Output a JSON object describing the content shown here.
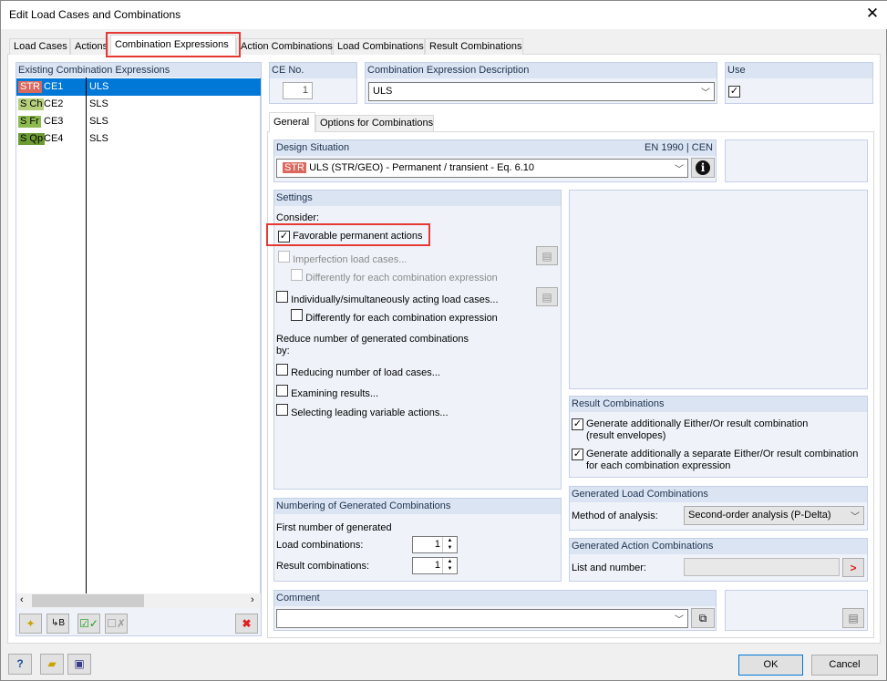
{
  "window": {
    "title": "Edit Load Cases and Combinations",
    "close": "✕"
  },
  "tabs": [
    "Load Cases",
    "Actions",
    "Combination Expressions",
    "Action Combinations",
    "Load Combinations",
    "Result Combinations"
  ],
  "left": {
    "header": "Existing Combination Expressions",
    "rows": [
      {
        "tag": "STR",
        "tag_color": "#d9695f",
        "name": "CE1",
        "desc": "ULS"
      },
      {
        "tag": "S Ch",
        "tag_color": "#b5cf7d",
        "name": "CE2",
        "desc": "SLS"
      },
      {
        "tag": "S Fr",
        "tag_color": "#8dba4f",
        "name": "CE3",
        "desc": "SLS"
      },
      {
        "tag": "S Qp",
        "tag_color": "#6d9b33",
        "name": "CE4",
        "desc": "SLS"
      }
    ]
  },
  "ce_no": {
    "label": "CE No.",
    "value": "1"
  },
  "description": {
    "label": "Combination Expression Description",
    "value": "ULS"
  },
  "use": {
    "label": "Use",
    "checked": true
  },
  "inner_tabs": [
    "General",
    "Options for Combinations"
  ],
  "design_situation": {
    "label": "Design Situation",
    "standard": "EN 1990 | CEN",
    "tag": "STR",
    "value": "ULS (STR/GEO) - Permanent / transient - Eq. 6.10"
  },
  "settings": {
    "label": "Settings",
    "consider": "Consider:",
    "favorable": "Favorable permanent actions",
    "imperfection": "Imperfection load cases...",
    "diff1": "Differently for each combination expression",
    "individually": "Individually/simultaneously acting load cases...",
    "diff2": "Differently for each combination expression",
    "reduce": "Reduce number of generated combinations",
    "reduce2": "by:",
    "reducing": "Reducing number of load cases...",
    "examining": "Examining results...",
    "selecting": "Selecting leading variable actions..."
  },
  "result_combinations": {
    "label": "Result Combinations",
    "opt1a": "Generate additionally Either/Or result combination",
    "opt1b": "(result envelopes)",
    "opt2a": "Generate additionally a separate Either/Or result combination",
    "opt2b": "for each combination expression"
  },
  "generated_load": {
    "label": "Generated Load Combinations",
    "method_label": "Method of analysis:",
    "method": "Second-order analysis (P-Delta)"
  },
  "generated_action": {
    "label": "Generated Action Combinations",
    "list_label": "List and number:"
  },
  "numbering": {
    "label": "Numbering of Generated Combinations",
    "first": "First number of generated",
    "load_label": "Load combinations:",
    "load_value": "1",
    "result_label": "Result combinations:",
    "result_value": "1"
  },
  "comment": {
    "label": "Comment",
    "value": ""
  },
  "footer": {
    "ok": "OK",
    "cancel": "Cancel"
  }
}
